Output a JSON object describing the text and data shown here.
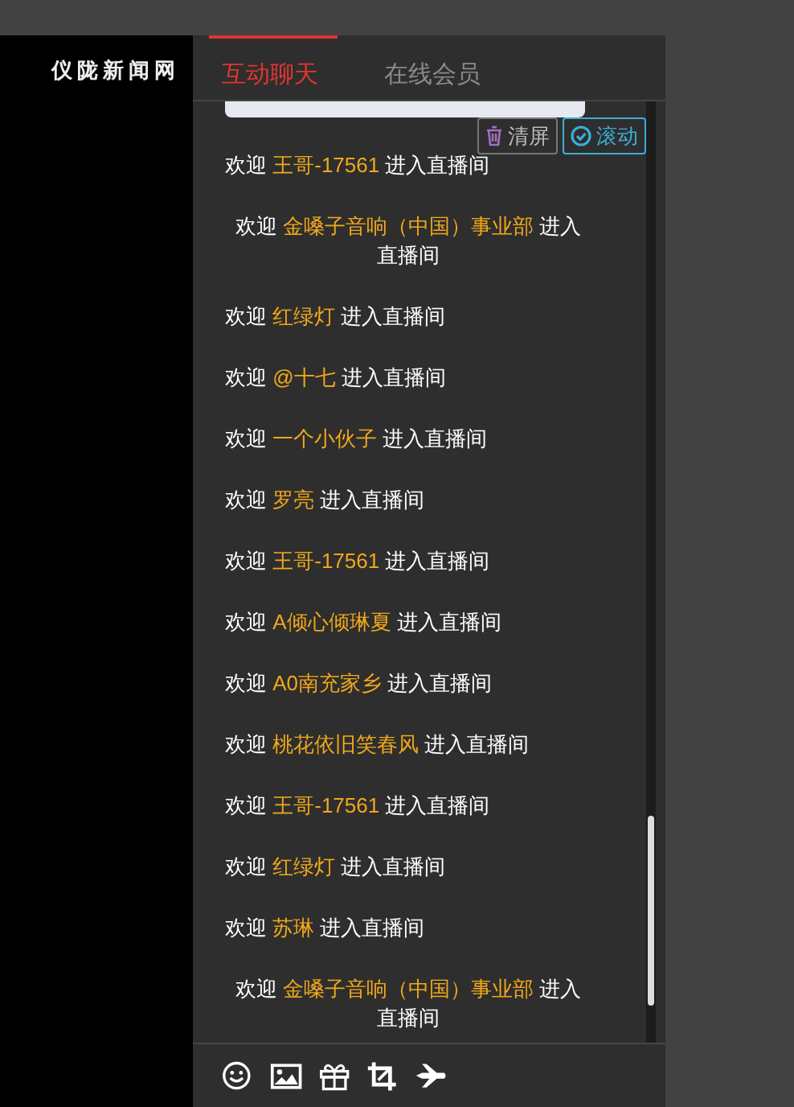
{
  "logo": "仪陇新闻网",
  "tabs": [
    {
      "label": "互动聊天",
      "selected": true
    },
    {
      "label": "在线会员",
      "selected": false
    }
  ],
  "actions": [
    {
      "kind": "clear",
      "label": "清屏"
    },
    {
      "kind": "scroll",
      "label": "滚动"
    }
  ],
  "messages": [
    {
      "prefix": "欢迎",
      "name": "王哥-17561",
      "suffix": "进入直播间"
    },
    {
      "prefix": "欢迎",
      "name": "金嗓子音响（中国）事业部",
      "suffix": "进入直播间"
    },
    {
      "prefix": "欢迎",
      "name": "红绿灯",
      "suffix": "进入直播间"
    },
    {
      "prefix": "欢迎",
      "name": "@十七",
      "suffix": "进入直播间"
    },
    {
      "prefix": "欢迎",
      "name": "一个小伙子",
      "suffix": "进入直播间"
    },
    {
      "prefix": "欢迎",
      "name": "罗亮",
      "suffix": "进入直播间"
    },
    {
      "prefix": "欢迎",
      "name": "王哥-17561",
      "suffix": "进入直播间"
    },
    {
      "prefix": "欢迎",
      "name": "A倾心倾琳夏",
      "suffix": "进入直播间"
    },
    {
      "prefix": "欢迎",
      "name": "A0南充家乡",
      "suffix": "进入直播间"
    },
    {
      "prefix": "欢迎",
      "name": "桃花依旧笑春风",
      "suffix": "进入直播间"
    },
    {
      "prefix": "欢迎",
      "name": "王哥-17561",
      "suffix": "进入直播间"
    },
    {
      "prefix": "欢迎",
      "name": "红绿灯",
      "suffix": "进入直播间"
    },
    {
      "prefix": "欢迎",
      "name": "苏琳",
      "suffix": "进入直播间"
    },
    {
      "prefix": "欢迎",
      "name": "金嗓子音响（中国）事业部",
      "suffix": "进入直播间"
    }
  ],
  "toolbar": [
    {
      "kind": "emoji"
    },
    {
      "kind": "image"
    },
    {
      "kind": "gift"
    },
    {
      "kind": "crop"
    },
    {
      "kind": "plane"
    }
  ]
}
